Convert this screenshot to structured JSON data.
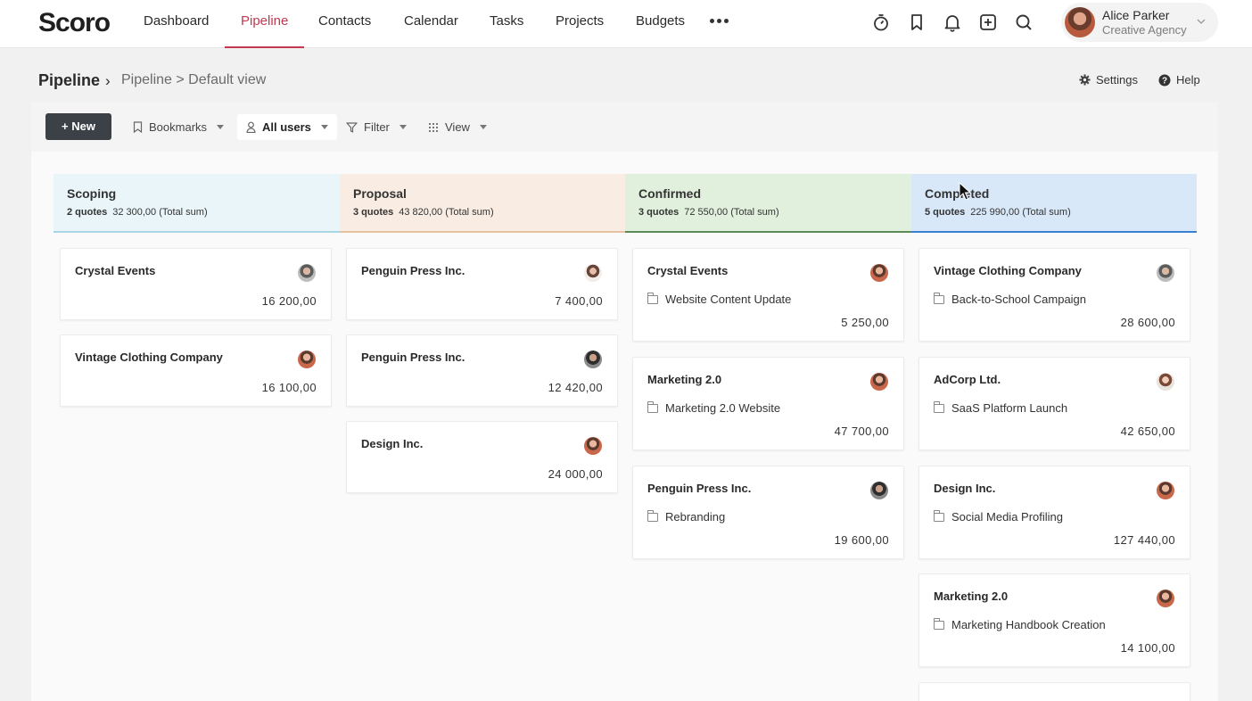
{
  "app": {
    "logo": "Scoro"
  },
  "nav": {
    "items": [
      {
        "label": "Dashboard",
        "active": false
      },
      {
        "label": "Pipeline",
        "active": true
      },
      {
        "label": "Contacts",
        "active": false
      },
      {
        "label": "Calendar",
        "active": false
      },
      {
        "label": "Tasks",
        "active": false
      },
      {
        "label": "Projects",
        "active": false
      },
      {
        "label": "Budgets",
        "active": false
      }
    ],
    "more_icon": "more-dots-icon",
    "tool_icons": [
      "timer-icon",
      "bookmark-icon",
      "bell-icon",
      "add-square-icon",
      "search-icon"
    ]
  },
  "user": {
    "name": "Alice Parker",
    "org": "Creative Agency"
  },
  "breadcrumb": {
    "title": "Pipeline",
    "separator": "›",
    "path": "Pipeline > Default view"
  },
  "header_links": {
    "settings": "Settings",
    "help": "Help"
  },
  "toolbar": {
    "new_label": "+ New",
    "bookmarks_label": "Bookmarks",
    "users_label": "All users",
    "filter_label": "Filter",
    "view_label": "View"
  },
  "colors": {
    "accent": "#c23a50",
    "scoping": "#e9f5f9",
    "proposal": "#f8ece3",
    "confirmed": "#e1f0dd",
    "completed": "#d8e8f8"
  },
  "columns": [
    {
      "name": "Scoping",
      "count": "2 quotes",
      "sum": "32 300,00 (Total sum)",
      "cards": [
        {
          "client": "Crystal Events",
          "project": "",
          "amount": "16 200,00"
        },
        {
          "client": "Vintage Clothing Company",
          "project": "",
          "amount": "16 100,00"
        }
      ]
    },
    {
      "name": "Proposal",
      "count": "3 quotes",
      "sum": "43 820,00 (Total sum)",
      "cards": [
        {
          "client": "Penguin Press Inc.",
          "project": "",
          "amount": "7 400,00"
        },
        {
          "client": "Penguin Press Inc.",
          "project": "",
          "amount": "12 420,00"
        },
        {
          "client": "Design Inc.",
          "project": "",
          "amount": "24 000,00"
        }
      ]
    },
    {
      "name": "Confirmed",
      "count": "3 quotes",
      "sum": "72 550,00 (Total sum)",
      "cards": [
        {
          "client": "Crystal Events",
          "project": "Website Content Update",
          "amount": "5 250,00"
        },
        {
          "client": "Marketing 2.0",
          "project": "Marketing 2.0 Website",
          "amount": "47 700,00"
        },
        {
          "client": "Penguin Press Inc.",
          "project": "Rebranding",
          "amount": "19 600,00"
        }
      ]
    },
    {
      "name": "Completed",
      "count": "5 quotes",
      "sum": "225 990,00 (Total sum)",
      "cards": [
        {
          "client": "Vintage Clothing Company",
          "project": "Back-to-School Campaign",
          "amount": "28 600,00"
        },
        {
          "client": "AdCorp Ltd.",
          "project": "SaaS Platform Launch",
          "amount": "42 650,00"
        },
        {
          "client": "Design Inc.",
          "project": "Social Media Profiling",
          "amount": "127 440,00"
        },
        {
          "client": "Marketing 2.0",
          "project": "Marketing Handbook Creation",
          "amount": "14 100,00"
        }
      ]
    }
  ]
}
